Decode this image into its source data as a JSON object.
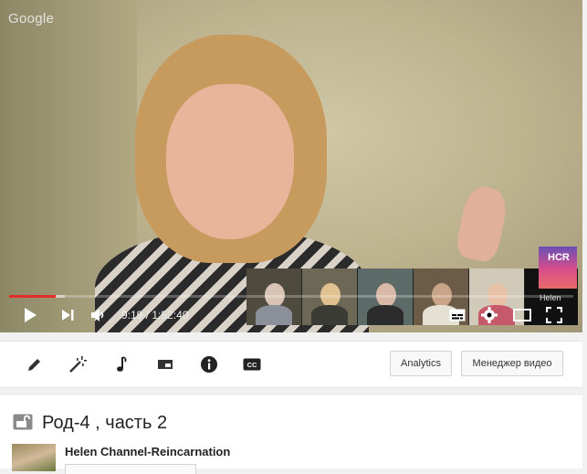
{
  "player": {
    "watermark": "Google",
    "time_current": "9:19",
    "time_separator": " / ",
    "time_total": "1:52:40",
    "progress_played_fraction": 0.083,
    "progress_buffered_fraction": 0.099,
    "participants_strip": {
      "logo_text": "HCR",
      "speaker_name": "Helen"
    },
    "controls": {
      "play_icon": "play-icon",
      "next_icon": "next-icon",
      "volume_icon": "volume-icon",
      "subtitles_icon": "subtitles-icon",
      "settings_icon": "gear-icon",
      "theater_icon": "theater-mode-icon",
      "fullscreen_icon": "fullscreen-icon"
    }
  },
  "toolbar": {
    "tools": [
      "pencil-icon",
      "magic-wand-icon",
      "music-note-icon",
      "end-screen-icon",
      "info-icon",
      "closed-captions-icon"
    ],
    "cc_label": "CC",
    "analytics_label": "Analytics",
    "video_manager_label": "Менеджер видео"
  },
  "video": {
    "title": "Род-4 , часть 2",
    "privacy_icon": "lock-icon",
    "channel_name": "Helen Channel-Reincarnation"
  },
  "colors": {
    "progress_played": "#e52d27",
    "background": "#f1f1f1",
    "accent_logo": "#d94e8a"
  }
}
